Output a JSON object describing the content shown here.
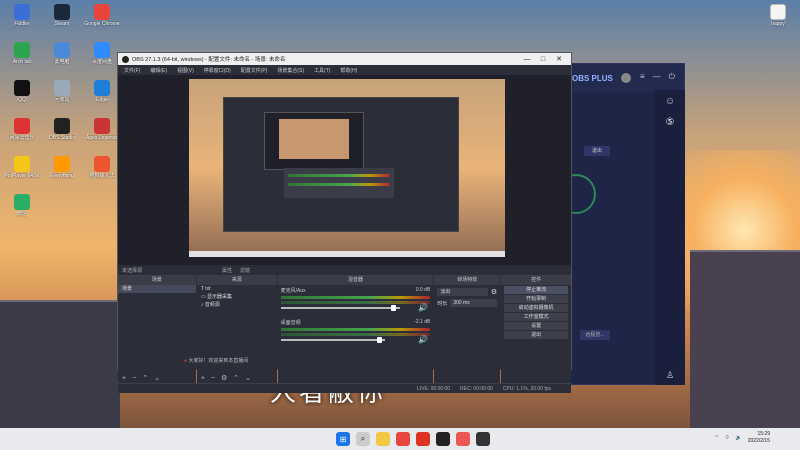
{
  "obs": {
    "title": "OBS 27.1.3 (64-bit, windows) - 配置文件: 未命名 - 场景: 未命名",
    "window_controls": [
      "—",
      "□",
      "✕"
    ],
    "menu": [
      "文件(F)",
      "编辑(E)",
      "视图(V)",
      "停靠窗口(D)",
      "配置文件(P)",
      "场景集合(S)",
      "工具(T)",
      "帮助(H)"
    ],
    "source_toolbar": {
      "prefix": "未选择源",
      "properties": "属性",
      "filters": "滤镜"
    },
    "docks": {
      "scenes": {
        "title": "场景",
        "items": [
          "场景"
        ]
      },
      "sources": {
        "title": "来源",
        "items": [
          "txt",
          "显示器采集",
          "音频源"
        ]
      },
      "mixer": {
        "title": "混音器",
        "channels": [
          {
            "name": "麦克风/Aux",
            "db": "0.0 dB"
          },
          {
            "name": "桌面音频",
            "db": "-2.1 dB"
          }
        ]
      },
      "transitions": {
        "title": "转场特效",
        "type": "淡出",
        "duration_label": "时长",
        "duration": "300 ms"
      },
      "controls": {
        "title": "控件",
        "buttons": [
          "停止推流",
          "开始录制",
          "启动虚拟摄像机",
          "工作室模式",
          "设置",
          "退出"
        ]
      }
    },
    "status": {
      "live": "LIVE: 00:00:00",
      "rec": "REC: 00:00:00",
      "cpu": "CPU: 1.1%, 30.00 fps"
    },
    "footer_note": "大家好！欢迎来到本直播间"
  },
  "bg_app": {
    "brand": "OBS PLUS",
    "exit": "退出",
    "footer": "远程管..."
  },
  "desktop": {
    "lyric": "人者敝你",
    "top_right_icon": "happy",
    "left_icons": [
      "Fiddler",
      "Steam",
      "Google Chrome",
      "Arch lab",
      "此电脑",
      "百度网盘",
      "QQ",
      "回收站",
      "Edge",
      "网易云音乐",
      "OBS Studio",
      "Apex Legends",
      "PotPlayer 64 bit",
      "Everything",
      "搜狗输入法",
      "微信"
    ]
  },
  "taskbar": {
    "icons": [
      "windows-icon",
      "search-icon",
      "file-explorer-icon",
      "chrome-icon",
      "netease-icon",
      "obs-icon",
      "app-icon",
      "terminal-icon"
    ],
    "time": "15:29",
    "date": "2022/2/15"
  }
}
